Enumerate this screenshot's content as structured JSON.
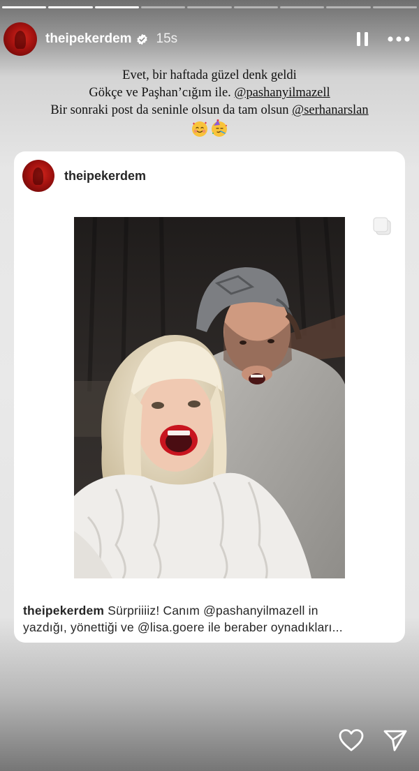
{
  "story": {
    "segments_total": 9,
    "segments_viewed": 3,
    "username": "theipekerdem",
    "time": "15s"
  },
  "caption": {
    "line1": "Evet, bir haftada güzel denk geldi",
    "line2_text": "Gökçe ve Paşhan’cığım ile.  ",
    "line2_mention": "@pashanyilmazell",
    "line3_text": "Bir sonraki post da seninle olsun da tam olsun ",
    "line3_mention": "@serhanarslan",
    "emojis": [
      "smiling-face-with-hearts",
      "partying-face"
    ]
  },
  "post": {
    "username": "theipekerdem",
    "caption_user": "theipekerdem",
    "caption_line1": " Sürpriiiiz! Canım @pashanyilmazell in",
    "caption_line2": "yazdığı, yönettiği ve @lisa.goere ile beraber oynadıkları..."
  },
  "icons": {
    "verified": "verified-badge-icon",
    "pause": "pause-icon",
    "more": "more-icon",
    "carousel": "carousel-icon",
    "like": "heart-icon",
    "share": "send-icon"
  }
}
